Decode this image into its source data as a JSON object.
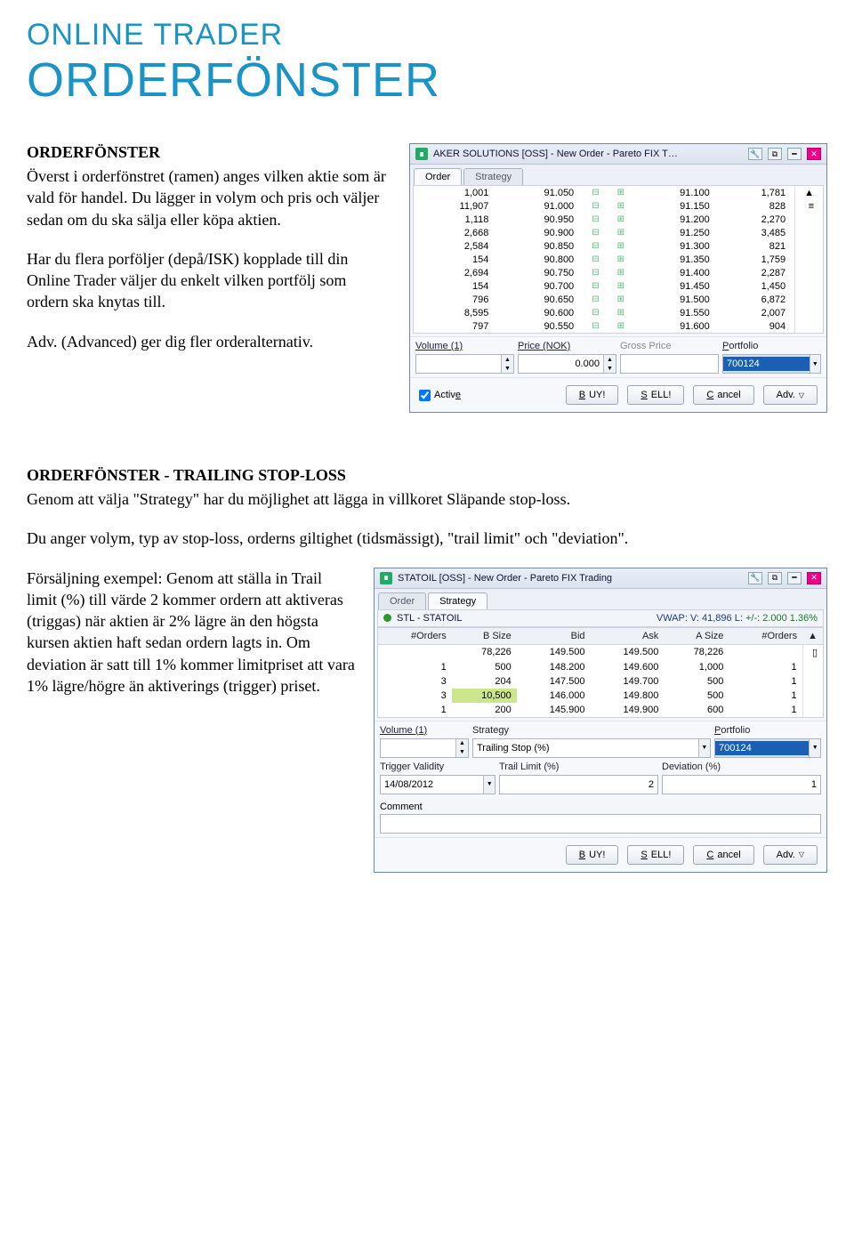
{
  "header": {
    "pretitle": "ONLINE TRADER",
    "title": "ORDERFÖNSTER"
  },
  "section1": {
    "heading": "ORDERFÖNSTER",
    "p1": "Överst i orderfönstret (ramen) anges vilken aktie som är vald för handel. Du lägger in volym och pris och väljer sedan om du ska sälja eller köpa aktien.",
    "p2": "Har du flera porföljer (depå/ISK) kopplade till din Online Trader väljer du enkelt vilken portfölj som ordern ska knytas till.",
    "p3": "Adv. (Advanced) ger dig fler orderalternativ."
  },
  "window1": {
    "title": "AKER SOLUTIONS [OSS] - New Order - Pareto FIX T…",
    "tabs": {
      "order": "Order",
      "strategy": "Strategy"
    },
    "rows": [
      {
        "v": "1,001",
        "p": "91.050",
        "p2": "91.100",
        "v2": "1,781"
      },
      {
        "v": "11,907",
        "p": "91.000",
        "p2": "91.150",
        "v2": "828"
      },
      {
        "v": "1,118",
        "p": "90.950",
        "p2": "91.200",
        "v2": "2,270"
      },
      {
        "v": "2,668",
        "p": "90.900",
        "p2": "91.250",
        "v2": "3,485"
      },
      {
        "v": "2,584",
        "p": "90.850",
        "p2": "91.300",
        "v2": "821"
      },
      {
        "v": "154",
        "p": "90.800",
        "p2": "91.350",
        "v2": "1,759"
      },
      {
        "v": "2,694",
        "p": "90.750",
        "p2": "91.400",
        "v2": "2,287"
      },
      {
        "v": "154",
        "p": "90.700",
        "p2": "91.450",
        "v2": "1,450"
      },
      {
        "v": "796",
        "p": "90.650",
        "p2": "91.500",
        "v2": "6,872"
      },
      {
        "v": "8,595",
        "p": "90.600",
        "p2": "91.550",
        "v2": "2,007"
      },
      {
        "v": "797",
        "p": "90.550",
        "p2": "91.600",
        "v2": "904"
      }
    ],
    "labels": {
      "volume": "Volume (1)",
      "price": "Price (NOK)",
      "gross": "Gross Price",
      "portfolio": "Portfolio"
    },
    "values": {
      "volume": "",
      "price": "0.000",
      "gross": "",
      "portfolio": "700124"
    },
    "buttons": {
      "active": "Active",
      "buy": "BUY!",
      "sell": "SELL!",
      "cancel": "Cancel",
      "adv": "Adv."
    },
    "plus": "+",
    "minus": "−"
  },
  "section2": {
    "heading": "ORDERFÖNSTER - TRAILING STOP-LOSS",
    "p1": "Genom att välja \"Strategy\" har du möjlighet att lägga in villkoret Släpande stop-loss.",
    "p2": "Du anger volym, typ av stop-loss, orderns giltighet (tidsmässigt), \"trail limit\" och \"deviation\".",
    "p3": "Försäljning exempel: Genom att ställa in Trail limit (%) till värde 2 kommer ordern att aktiveras (triggas) när aktien är 2% lägre än den högsta kursen aktien haft sedan ordern lagts in. Om deviation är satt till 1% kommer limitpriset att vara 1% lägre/högre än aktiverings (trigger) priset."
  },
  "window2": {
    "title": "STATOIL [OSS] - New Order - Pareto FIX Trading",
    "tabs": {
      "order": "Order",
      "strategy": "Strategy"
    },
    "banner": {
      "ticker": "STL - STATOIL",
      "vwap": "VWAP:",
      "v": "V: 41,896",
      "l": "L:",
      "chg": "+/-: 2.000 1.36%"
    },
    "headers": [
      "#Orders",
      "B Size",
      "Bid",
      "Ask",
      "A Size",
      "#Orders"
    ],
    "rows": [
      {
        "no": "",
        "bs": "78,226",
        "bid": "149.500",
        "ask": "149.500",
        "as": "78,226",
        "na": ""
      },
      {
        "no": "1",
        "bs": "500",
        "bid": "148.200",
        "ask": "149.600",
        "as": "1,000",
        "na": "1"
      },
      {
        "no": "3",
        "bs": "204",
        "bid": "147.500",
        "ask": "149.700",
        "as": "500",
        "na": "1"
      },
      {
        "no": "3",
        "bs": "10,500",
        "bid": "146.000",
        "ask": "149.800",
        "as": "500",
        "na": "1"
      },
      {
        "no": "1",
        "bs": "200",
        "bid": "145.900",
        "ask": "149.900",
        "as": "600",
        "na": "1"
      }
    ],
    "labels": {
      "volume": "Volume (1)",
      "strategy": "Strategy",
      "portfolio": "Portfolio",
      "trigger": "Trigger Validity",
      "trail": "Trail Limit (%)",
      "deviation": "Deviation (%)",
      "comment": "Comment"
    },
    "values": {
      "volume": "",
      "strategy": "Trailing Stop (%)",
      "portfolio": "700124",
      "trigger": "14/08/2012",
      "trail": "2",
      "deviation": "1",
      "comment": ""
    },
    "buttons": {
      "buy": "BUY!",
      "sell": "SELL!",
      "cancel": "Cancel",
      "adv": "Adv."
    }
  }
}
